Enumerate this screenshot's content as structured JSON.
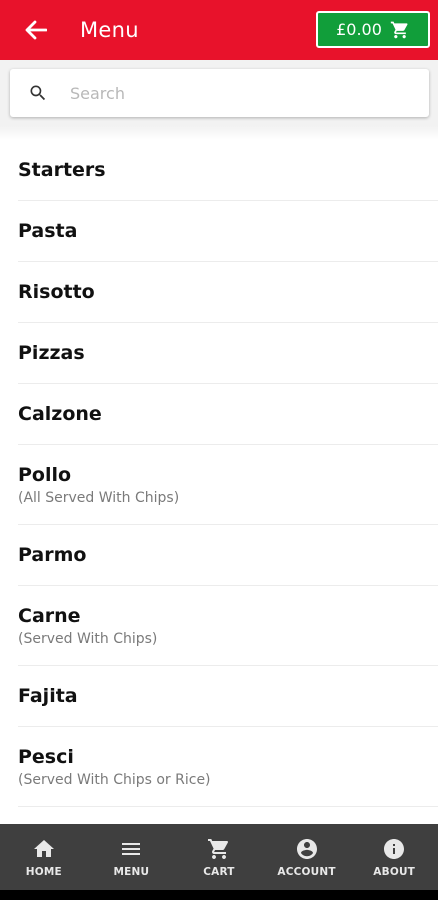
{
  "header": {
    "title": "Menu",
    "back_icon": "arrow-left-icon",
    "cart_total": "£0.00",
    "cart_icon": "cart-icon",
    "bg_color": "#e8122b",
    "cart_bg_color": "#119e3a"
  },
  "search": {
    "placeholder": "Search",
    "value": "",
    "icon": "search-icon"
  },
  "menu": {
    "items": [
      {
        "label": "Starters",
        "sub": ""
      },
      {
        "label": "Pasta",
        "sub": ""
      },
      {
        "label": "Risotto",
        "sub": ""
      },
      {
        "label": "Pizzas",
        "sub": ""
      },
      {
        "label": "Calzone",
        "sub": ""
      },
      {
        "label": "Pollo",
        "sub": "(All Served With Chips)"
      },
      {
        "label": "Parmo",
        "sub": ""
      },
      {
        "label": "Carne",
        "sub": "(Served With Chips)"
      },
      {
        "label": "Fajita",
        "sub": ""
      },
      {
        "label": "Pesci",
        "sub": "(Served With Chips or Rice)"
      }
    ]
  },
  "bottom_nav": {
    "items": [
      {
        "label": "HOME",
        "icon": "home-icon"
      },
      {
        "label": "MENU",
        "icon": "menu-icon"
      },
      {
        "label": "CART",
        "icon": "cart-icon"
      },
      {
        "label": "ACCOUNT",
        "icon": "account-icon"
      },
      {
        "label": "ABOUT",
        "icon": "info-icon"
      }
    ],
    "bg_color": "#3f3f3f"
  }
}
